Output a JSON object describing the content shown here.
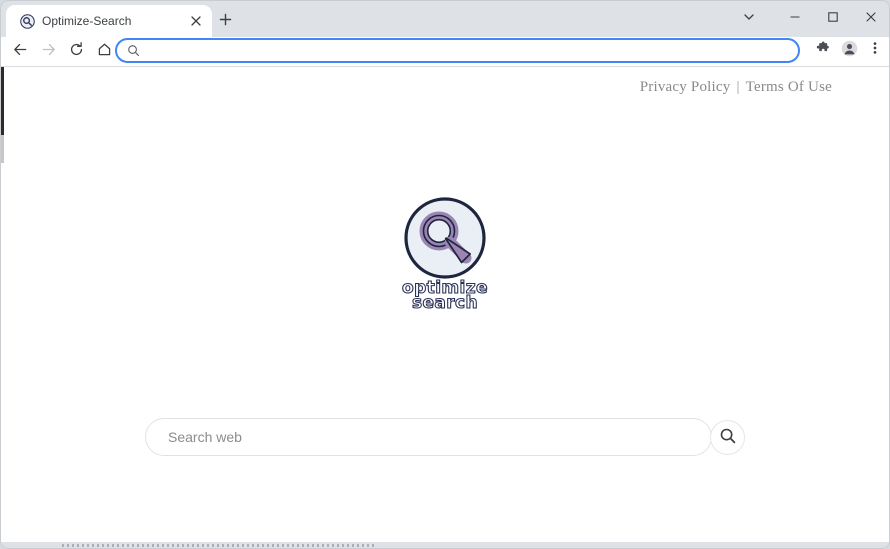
{
  "browser": {
    "tab": {
      "title": "Optimize-Search",
      "favicon_icon": "magnifier-favicon",
      "close_icon": "close-icon"
    },
    "new_tab_icon": "plus-icon",
    "window_controls": [
      {
        "name": "tab-search",
        "icon": "chevron-down-icon"
      },
      {
        "name": "minimize",
        "icon": "minimize-icon"
      },
      {
        "name": "maximize",
        "icon": "maximize-icon"
      },
      {
        "name": "close",
        "icon": "close-icon"
      }
    ],
    "nav": [
      {
        "name": "back",
        "icon": "arrow-left-icon",
        "enabled": true
      },
      {
        "name": "forward",
        "icon": "arrow-right-icon",
        "enabled": false
      },
      {
        "name": "reload",
        "icon": "reload-icon",
        "enabled": true
      },
      {
        "name": "home",
        "icon": "home-icon",
        "enabled": true
      }
    ],
    "omnibox": {
      "value": "",
      "placeholder": "",
      "icon": "search-icon"
    },
    "toolbar_right": [
      {
        "name": "extensions",
        "icon": "puzzle-icon"
      },
      {
        "name": "profile",
        "icon": "avatar-icon"
      },
      {
        "name": "chrome-menu",
        "icon": "three-dots-icon"
      }
    ]
  },
  "page": {
    "links": {
      "privacy": "Privacy Policy",
      "separator": "|",
      "terms": "Terms Of Use"
    },
    "logo": {
      "icon": "magnifier-logo-icon",
      "word1": "optimize",
      "word2": "search",
      "disc_color": "#e9eff5",
      "outline_color": "#20253f",
      "glass_color": "#9a85b4"
    },
    "search": {
      "value": "",
      "placeholder": "Search web",
      "button_icon": "search-icon"
    }
  }
}
